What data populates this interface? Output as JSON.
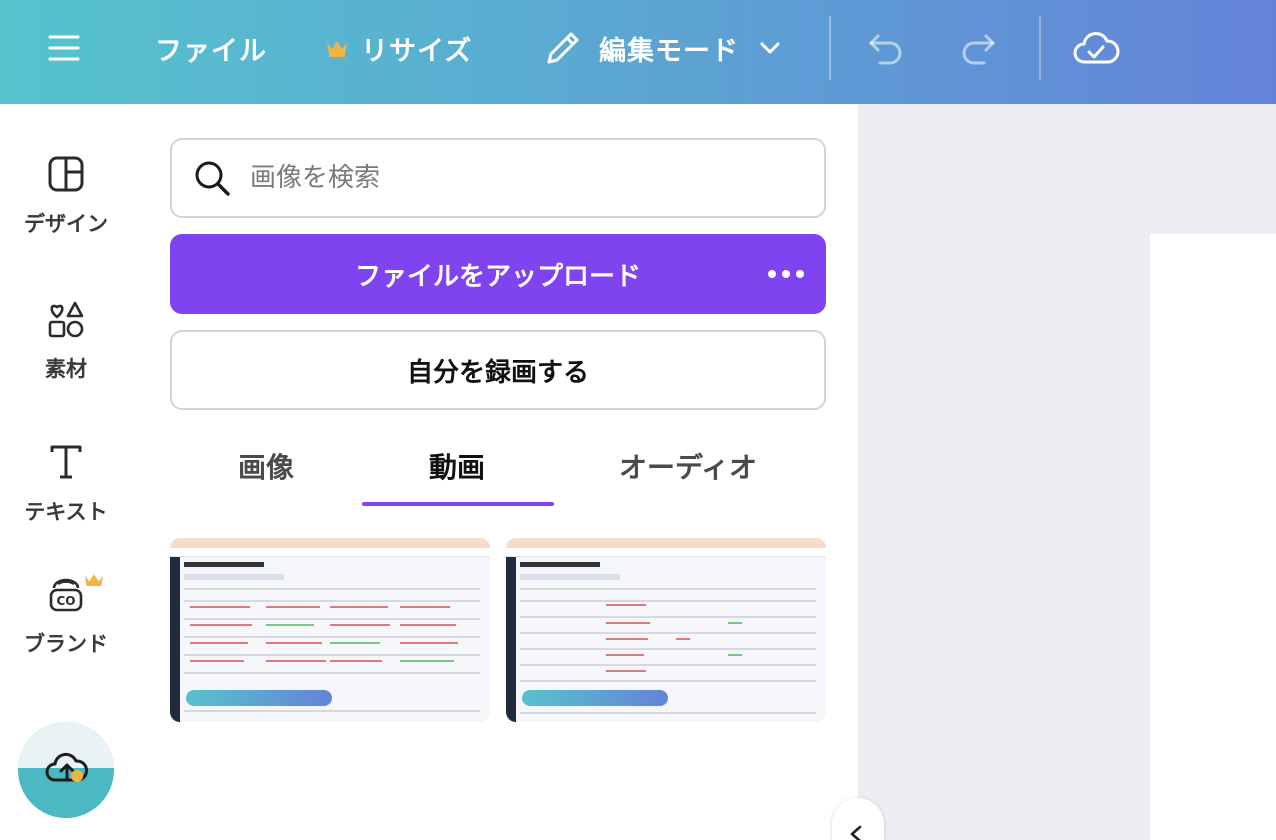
{
  "topbar": {
    "menu_icon": "hamburger-icon",
    "file_label": "ファイル",
    "resize_label": "リサイズ",
    "resize_icon": "crown-icon",
    "edit_mode_label": "編集モード",
    "edit_mode_icon": "pencil-icon",
    "undo_icon": "undo-icon",
    "redo_icon": "redo-icon",
    "save_status_icon": "cloud-check-icon",
    "colors": {
      "gradient_start": "#56c3cd",
      "gradient_end": "#6483d8",
      "crown": "#f2b544"
    }
  },
  "rail": {
    "items": [
      {
        "label": "デザイン",
        "icon": "design-layout-icon"
      },
      {
        "label": "素材",
        "icon": "elements-shapes-icon"
      },
      {
        "label": "テキスト",
        "icon": "text-t-icon"
      },
      {
        "label": "ブランド",
        "icon": "brand-kit-icon"
      }
    ],
    "upload_icon": "cloud-upload-icon"
  },
  "panel": {
    "search": {
      "placeholder": "画像を検索",
      "value": ""
    },
    "upload_button_label": "ファイルをアップロード",
    "record_button_label": "自分を録画する",
    "tabs": [
      {
        "label": "画像",
        "active": false
      },
      {
        "label": "動画",
        "active": true
      },
      {
        "label": "オーディオ",
        "active": false
      }
    ],
    "accent_color": "#8043f0",
    "videos": [
      {
        "name": "video-thumbnail-1"
      },
      {
        "name": "video-thumbnail-2"
      }
    ]
  }
}
